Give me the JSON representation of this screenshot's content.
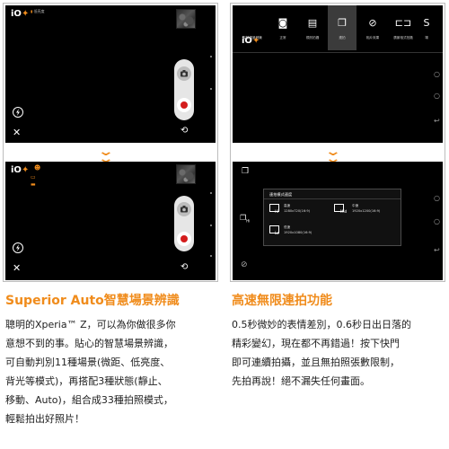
{
  "left_panel": {
    "top_screen": {
      "logo": "iO",
      "status_text": "低亮度"
    },
    "bottom_screen": {
      "logo": "iO"
    }
  },
  "right_panel": {
    "menu": {
      "logo": "iO",
      "items": [
        {
          "label": "智慧場景辨識",
          "icon": "scene-icon"
        },
        {
          "label": "正常",
          "icon": "camera-icon"
        },
        {
          "label": "視訊拍攝",
          "icon": "film-icon"
        },
        {
          "label": "連拍",
          "icon": "burst-icon"
        },
        {
          "label": "相片效果",
          "icon": "effect-icon"
        },
        {
          "label": "廣景相式拍攝",
          "icon": "panorama-icon"
        },
        {
          "label": "場",
          "icon": "s-icon"
        }
      ]
    },
    "dialog": {
      "title": "連拍模式速度",
      "options": [
        {
          "size": "Hi",
          "name": "高速",
          "res": "1280x720(16:9)"
        },
        {
          "size": "Mid",
          "name": "中速",
          "res": "1920x1200(16:9)"
        },
        {
          "size": "Lo",
          "name": "低速",
          "res": "1920x1080(16:9)"
        }
      ]
    }
  },
  "sections": {
    "left": {
      "heading": "Superior Auto智慧場景辨識",
      "lines": [
        "聰明的Xperia™ Z，可以為你做很多你",
        "意想不到的事。貼心的智慧場景辨識，",
        "可自動判別11種場景(微距、低亮度、",
        "背光等模式)，再搭配3種狀態(靜止、",
        "移動、Auto)，組合成33種拍照模式，",
        "輕鬆拍出好照片！"
      ]
    },
    "right": {
      "heading": "高速無限連拍功能",
      "lines": [
        "0.5秒微妙的表情差別，0.6秒日出日落的",
        "精彩變幻，現在都不再錯過！按下快門",
        "即可連續拍攝，並且無拍照張數限制，",
        "先拍再說！絕不漏失任何畫面。"
      ]
    }
  },
  "colors": {
    "accent": "#f08c1c",
    "record": "#d41c1c",
    "screen_bg": "#000000"
  }
}
